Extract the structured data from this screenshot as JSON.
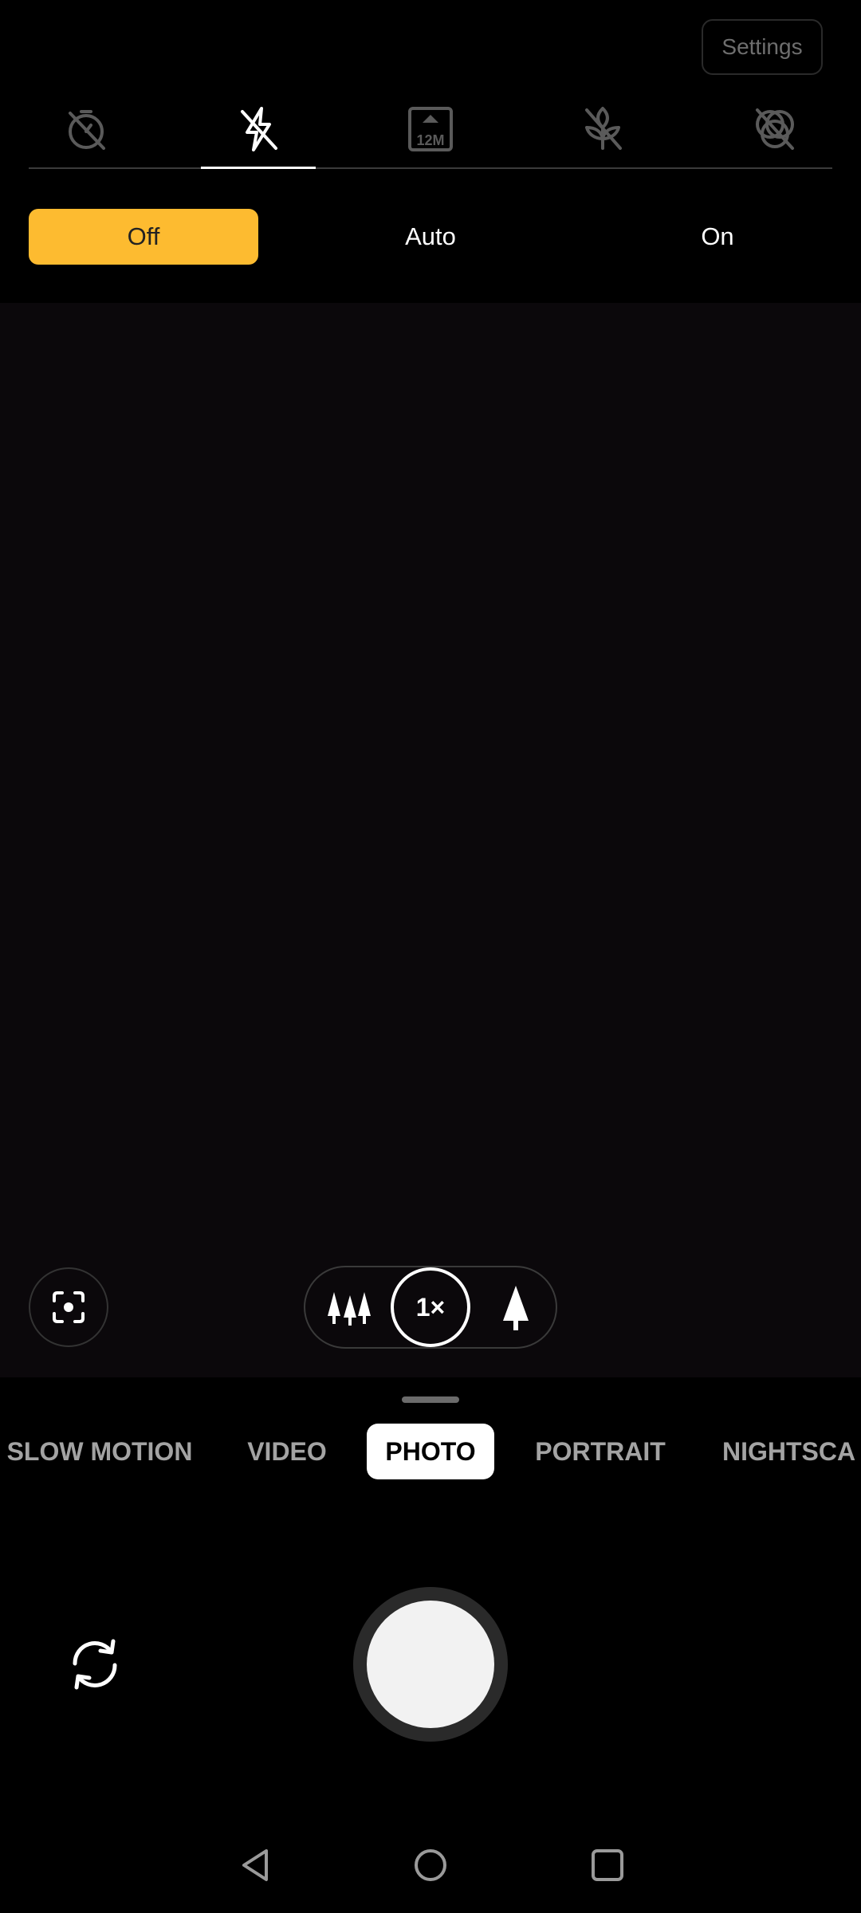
{
  "top_bar": {
    "settings_label": "Settings"
  },
  "quick_settings": {
    "items": [
      {
        "name": "timer-off-icon",
        "label": ""
      },
      {
        "name": "flash-off-icon",
        "label": ""
      },
      {
        "name": "resolution-icon",
        "label": "12M"
      },
      {
        "name": "macro-off-icon",
        "label": ""
      },
      {
        "name": "filter-off-icon",
        "label": ""
      }
    ],
    "active_index": 1
  },
  "flash_options": {
    "off": "Off",
    "auto": "Auto",
    "on": "On",
    "selected": "Off",
    "accent_color": "#fdbb30"
  },
  "zoom": {
    "current": "1×"
  },
  "modes": {
    "items": [
      "SLOW MOTION",
      "VIDEO",
      "PHOTO",
      "PORTRAIT",
      "NIGHTSCA"
    ],
    "active": "PHOTO"
  }
}
